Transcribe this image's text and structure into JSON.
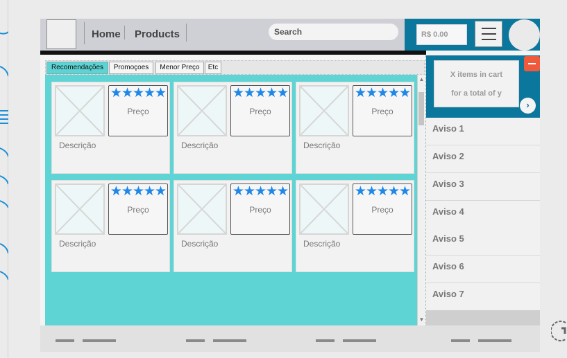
{
  "header": {
    "nav": [
      "Home",
      "Products"
    ],
    "search_placeholder": "Search",
    "price": "R$ 0.00"
  },
  "tabs": [
    "Recomendações",
    "Promoçoes",
    "Menor Preço",
    "Etc"
  ],
  "products": [
    {
      "stars": "★★★★★",
      "price_label": "Preço",
      "description": "Descrição"
    },
    {
      "stars": "★★★★★",
      "price_label": "Preço",
      "description": "Descrição"
    },
    {
      "stars": "★★★★★",
      "price_label": "Preço",
      "description": "Descrição"
    },
    {
      "stars": "★★★★★",
      "price_label": "Preço",
      "description": "Descrição"
    },
    {
      "stars": "★★★★★",
      "price_label": "Preço",
      "description": "Descrição"
    },
    {
      "stars": "★★★★★",
      "price_label": "Preço",
      "description": "Descrição"
    }
  ],
  "cart": {
    "line1": "X items in cart",
    "line2": "for a total of y",
    "next_icon": "chevron-right-icon",
    "remove_icon": "minus-icon"
  },
  "notices": [
    "Aviso 1",
    "Aviso 2",
    "Aviso 3",
    "Aviso 4",
    "Aviso 5",
    "Aviso 6",
    "Aviso 7"
  ],
  "icons": {
    "menu": "hamburger-menu-icon",
    "avatar": "avatar",
    "product_image": "image-placeholder-icon",
    "refresh": "refresh-icon"
  },
  "colors": {
    "accent": "#0b779c",
    "content_bg": "#5fd4d4",
    "star": "#1e87e8",
    "remove": "#ef5a3c"
  }
}
